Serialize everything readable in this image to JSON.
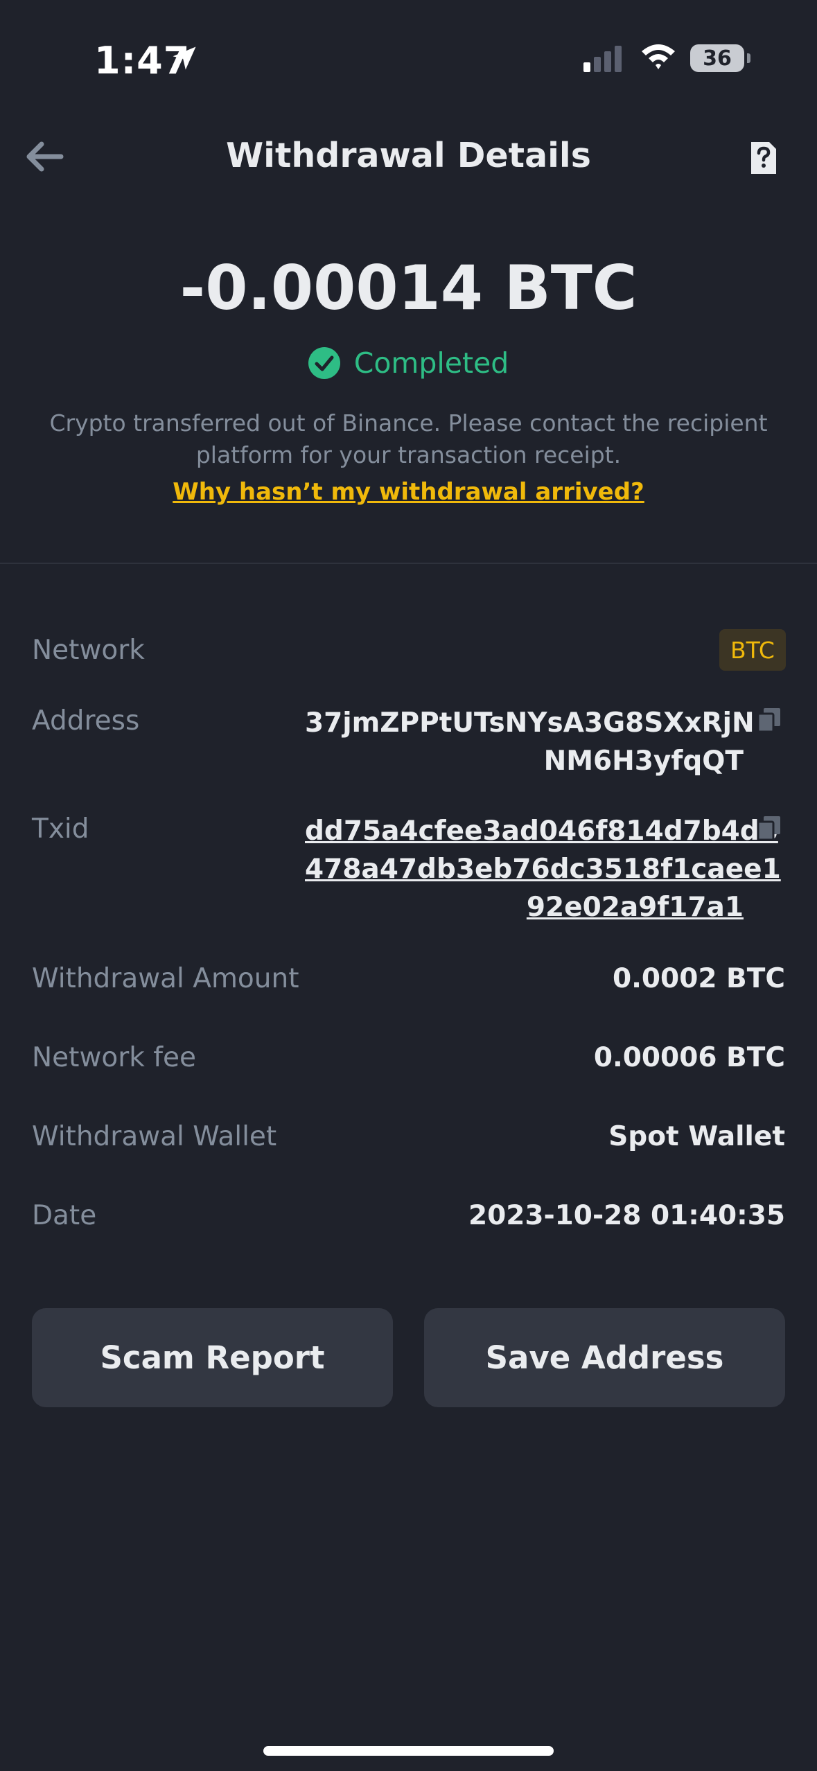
{
  "status_bar": {
    "time": "1:47",
    "battery": "36"
  },
  "header": {
    "title": "Withdrawal Details"
  },
  "summary": {
    "amount": "-0.00014 BTC",
    "status": "Completed",
    "description": "Crypto transferred out of Binance. Please contact the recipient platform for your transaction receipt.",
    "help_link": "Why hasn’t my withdrawal arrived?"
  },
  "details": {
    "network_label": "Network",
    "network_value": "BTC",
    "address_label": "Address",
    "address_line1": "37jmZPPtUTsNYsA3G8SXxRjN",
    "address_line2": "NM6H3yfqQT",
    "txid_label": "Txid",
    "txid_line1": "dd75a4cfee3ad046f814d7b4d6",
    "txid_line2": "478a47db3eb76dc3518f1caee1",
    "txid_line3": "92e02a9f17a1",
    "amount_label": "Withdrawal Amount",
    "amount_value": "0.0002 BTC",
    "fee_label": "Network fee",
    "fee_value": "0.00006 BTC",
    "wallet_label": "Withdrawal Wallet",
    "wallet_value": "Spot Wallet",
    "date_label": "Date",
    "date_value": "2023-10-28 01:40:35"
  },
  "buttons": {
    "scam_report": "Scam Report",
    "save_address": "Save Address"
  },
  "colors": {
    "background": "#1f222b",
    "success": "#2ebd85",
    "accent": "#f0b90b",
    "muted": "#848e9c"
  }
}
